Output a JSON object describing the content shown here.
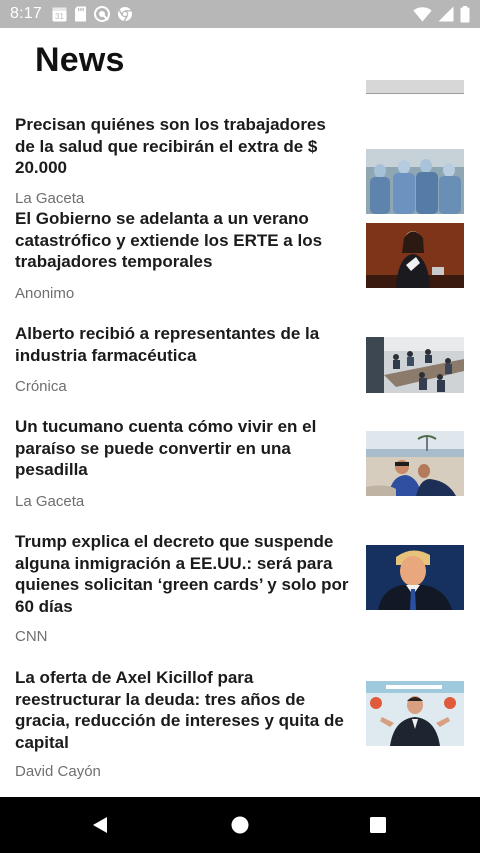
{
  "status_bar": {
    "time": "8:17",
    "calendar_day": "31",
    "icons_left": [
      "calendar-icon",
      "sd-card-icon",
      "vpn-icon",
      "chrome-icon"
    ],
    "icons_right": [
      "wifi-icon",
      "cell-signal-icon",
      "battery-icon"
    ]
  },
  "app_bar": {
    "title": "News"
  },
  "articles": [
    {
      "title": "Precisan quiénes son los trabajadores de la salud que recibirán el extra de $ 20.000",
      "source": "La Gaceta",
      "thumb": "health-workers-photo"
    },
    {
      "title": "El Gobierno se adelanta a un verano catastrófico y extiende los ERTE a los trabajadores temporales",
      "source": "Anonimo",
      "thumb": "politician-speaking-photo"
    },
    {
      "title": "Alberto recibió a representantes de la industria farmacéutica",
      "source": "Crónica",
      "thumb": "meeting-room-photo"
    },
    {
      "title": "Un tucumano cuenta cómo vivir en el paraíso se puede convertir en una pesadilla",
      "source": "La Gaceta",
      "thumb": "beach-couple-photo"
    },
    {
      "title": "Trump explica el decreto que suspende alguna inmigración a EE.UU.: será para quienes solicitan ‘green cards’ y solo por 60 días",
      "source": "CNN",
      "thumb": "trump-portrait-photo"
    },
    {
      "title": "La oferta de Axel Kicillof para reestructurar la deuda: tres años de gracia, reducción de intereses y quita de capital",
      "source": "David Cayón",
      "thumb": "kicillof-press-photo"
    }
  ],
  "nav_bar": {
    "buttons": [
      "back-button",
      "home-button",
      "recents-button"
    ]
  }
}
